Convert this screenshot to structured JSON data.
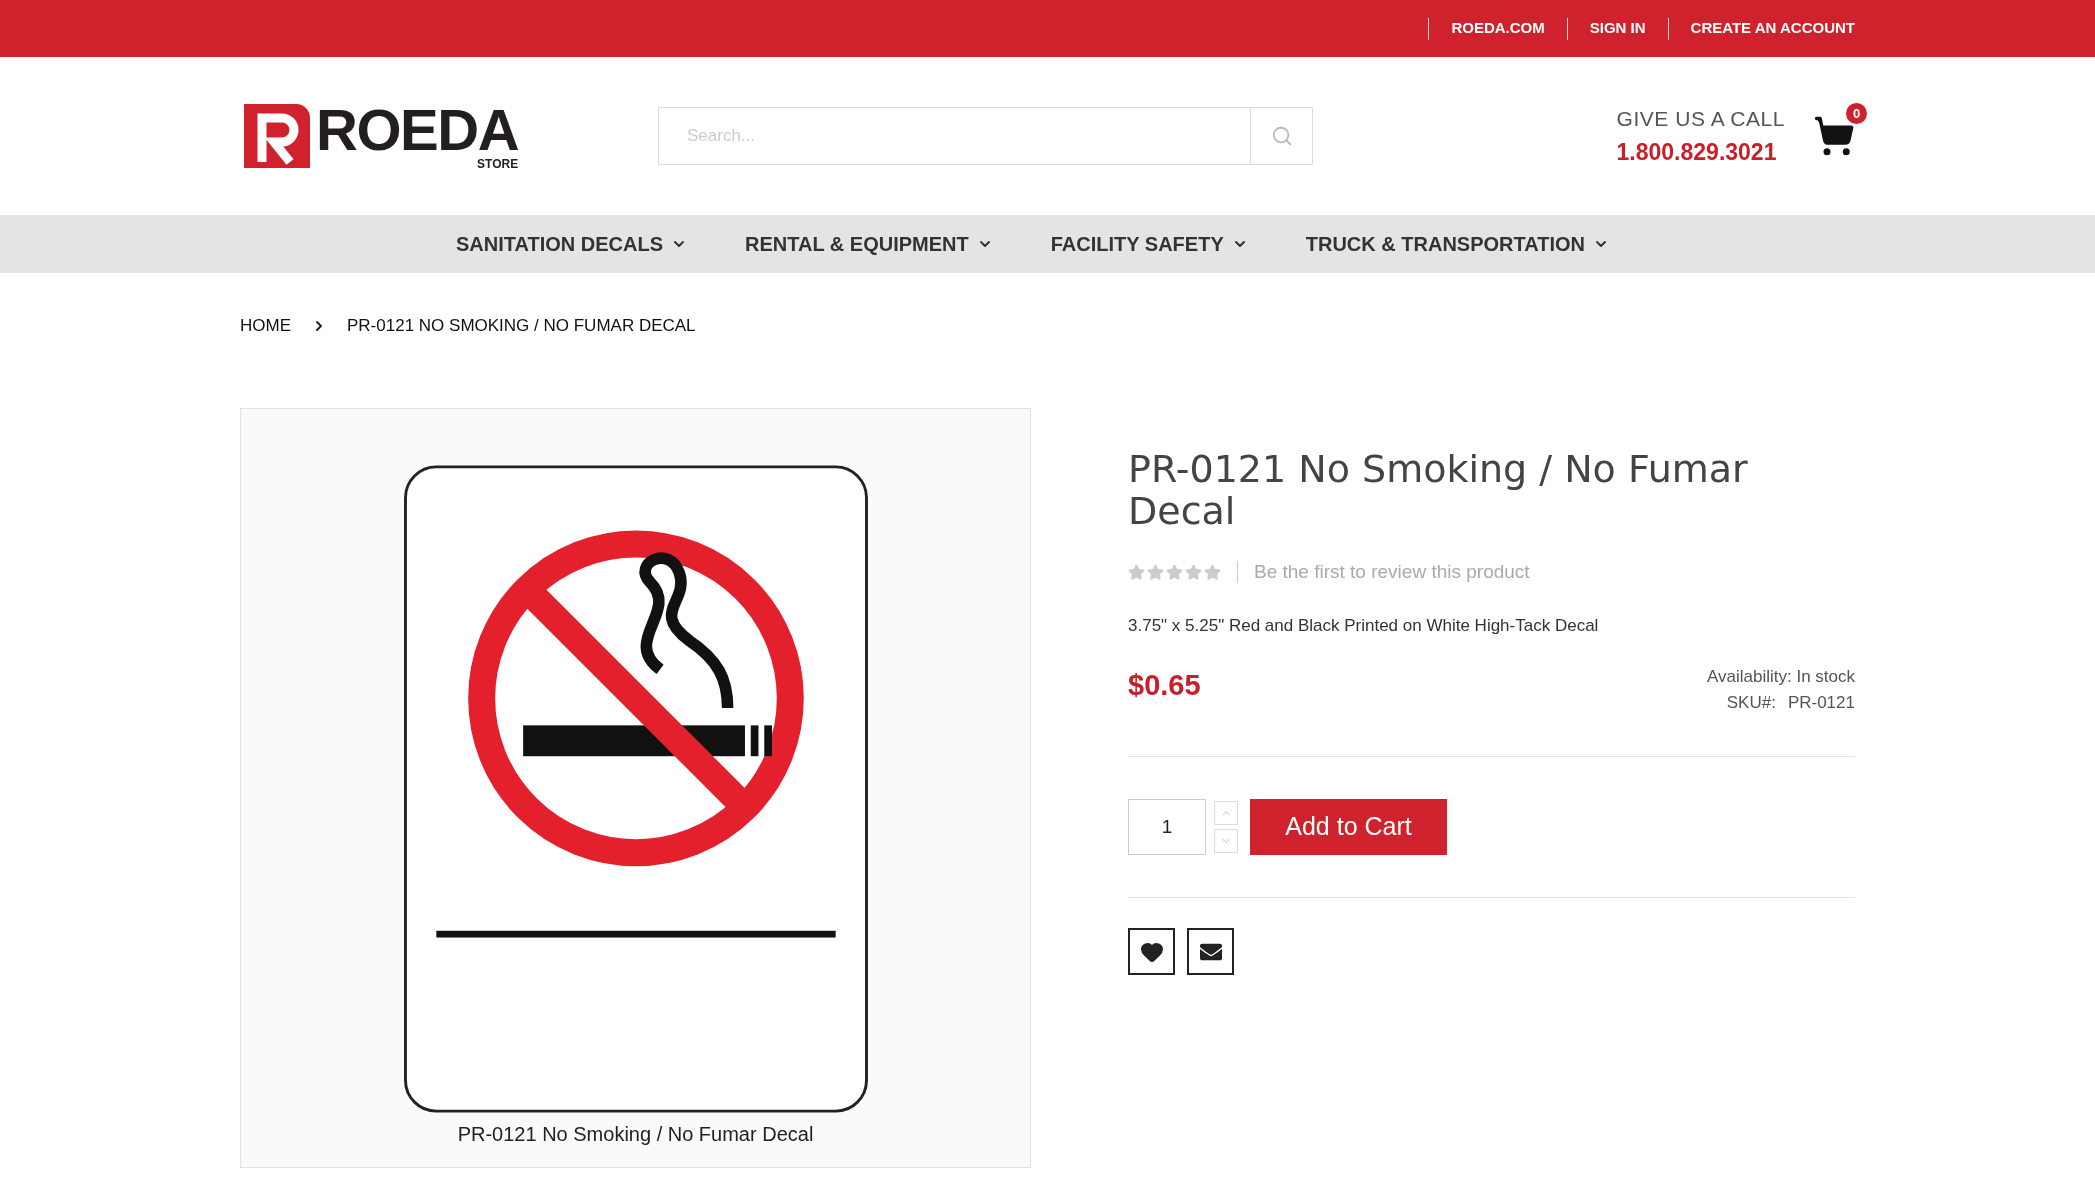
{
  "top_links": [
    "ROEDA.COM",
    "SIGN IN",
    "CREATE AN ACCOUNT"
  ],
  "logo": {
    "name": "ROEDA",
    "sub": "STORE"
  },
  "search": {
    "placeholder": "Search..."
  },
  "call": {
    "label": "GIVE US A CALL",
    "phone": "1.800.829.3021"
  },
  "cart": {
    "count": "0"
  },
  "nav": [
    "SANITATION DECALS",
    "RENTAL & EQUIPMENT",
    "FACILITY SAFETY",
    "TRUCK & TRANSPORTATION"
  ],
  "breadcrumb": [
    "HOME",
    "PR-0121 NO SMOKING / NO FUMAR DECAL"
  ],
  "product": {
    "image_caption": "PR-0121 No Smoking / No Fumar Decal",
    "title": "PR-0121 No Smoking / No Fumar Decal",
    "stars": 0,
    "review_link": "Be the first to review this product",
    "description": "3.75\" x 5.25\" Red and Black Printed on White High-Tack Decal",
    "price": "$0.65",
    "availability": "Availability: In stock",
    "sku_label": "SKU#:",
    "sku": "PR-0121",
    "quantity": "1",
    "add_button": "Add to Cart"
  }
}
